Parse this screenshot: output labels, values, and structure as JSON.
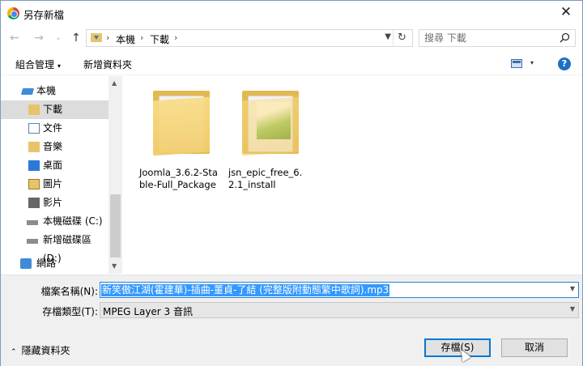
{
  "window": {
    "title": "另存新檔",
    "close_glyph": "✕"
  },
  "nav": {
    "back_glyph": "←",
    "forward_glyph": "→",
    "recent_glyph": "⌄",
    "up_glyph": "↑",
    "breadcrumbs": [
      "本機",
      "下載"
    ],
    "sep_glyph": "›",
    "refresh_glyph": "↻"
  },
  "search": {
    "placeholder": "搜尋 下載"
  },
  "toolbar": {
    "organize_label": "組合管理",
    "organize_caret": "▾",
    "new_folder_label": "新增資料夾",
    "view_caret": "▾",
    "help_glyph": "?"
  },
  "sidebar": {
    "items": [
      {
        "label": "本機",
        "icon": "pc-icon"
      },
      {
        "label": "下載",
        "icon": "downloads-folder-icon",
        "selected": true
      },
      {
        "label": "文件",
        "icon": "documents-icon"
      },
      {
        "label": "音樂",
        "icon": "music-icon"
      },
      {
        "label": "桌面",
        "icon": "desktop-icon"
      },
      {
        "label": "圖片",
        "icon": "pictures-icon"
      },
      {
        "label": "影片",
        "icon": "videos-icon"
      },
      {
        "label": "本機磁碟 (C:)",
        "icon": "drive-c-icon"
      },
      {
        "label": "新增磁碟區 (D:)",
        "icon": "drive-d-icon"
      },
      {
        "label": "網路",
        "icon": "network-icon"
      }
    ],
    "scroll_up_glyph": "▲",
    "scroll_down_glyph": "▼"
  },
  "files": [
    {
      "name": "Joomla_3.6.2-Stable-Full_Package",
      "icon": "folder-icon"
    },
    {
      "name": "jsn_epic_free_6.2.1_install",
      "icon": "folder-icon"
    }
  ],
  "form": {
    "filename_label": "檔案名稱(N):",
    "filename_value": "新笑傲江湖(霍建華)-插曲-董貞-了結 (完整版附動態繁中歌詞).mp3",
    "filetype_label": "存檔類型(T):",
    "filetype_value": "MPEG Layer 3 音訊",
    "dropdown_glyph": "▼"
  },
  "footer": {
    "hide_folders_label": "隱藏資料夾",
    "hide_folders_glyph": "⌃",
    "save_label": "存檔(S)",
    "cancel_label": "取消"
  },
  "colors": {
    "accent": "#0078d7",
    "selection": "#3399ff",
    "folder": "#e3b94f"
  }
}
